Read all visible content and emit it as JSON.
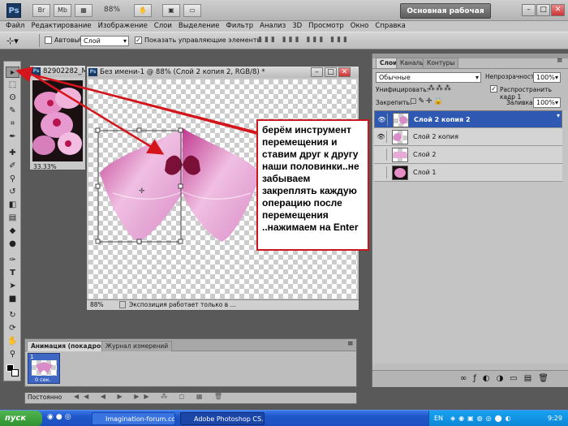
{
  "app": {
    "logo": "Ps",
    "zoom": "88%",
    "workspace": "Основная рабочая среда",
    "window_controls": [
      "–",
      "□",
      "✕"
    ]
  },
  "menu": [
    "Файл",
    "Редактирование",
    "Изображение",
    "Слои",
    "Выделение",
    "Фильтр",
    "Анализ",
    "3D",
    "Просмотр",
    "Окно",
    "Справка"
  ],
  "options": {
    "autoselect_label": "Автовыбор:",
    "autoselect_value": "Слой",
    "show_controls_label": "Показать управляющие элементы"
  },
  "doc_small": {
    "title": "82902282_M...",
    "zoom": "33.33%"
  },
  "doc_main": {
    "title": "Без имени-1 @ 88% (Слой 2 копия 2, RGB/8) *",
    "zoom": "88%",
    "status": "Экспозиция работает только в ..."
  },
  "callout": "берём инструмент перемещения и ставим  друг к другу наши половинки..не забываем закреплять каждую операцию после перемещения ..нажимаем на Enter",
  "layers_panel": {
    "tabs": [
      "Слои",
      "Каналы",
      "Контуры"
    ],
    "blend_mode": "Обычные",
    "opacity_label": "Непрозрачность:",
    "opacity_value": "100%",
    "unify_label": "Унифицировать:",
    "propagate_label": "Распространить кадр 1",
    "lock_label": "Закрепить:",
    "fill_label": "Заливка:",
    "fill_value": "100%",
    "layers": [
      {
        "name": "Слой 2 копия 2",
        "selected": true,
        "visible": true
      },
      {
        "name": "Слой 2 копия",
        "selected": false,
        "visible": true
      },
      {
        "name": "Слой 2",
        "selected": false,
        "visible": false
      },
      {
        "name": "Слой 1",
        "selected": false,
        "visible": false
      }
    ]
  },
  "animation_panel": {
    "tabs": [
      "Анимация (покадровая)",
      "Журнал измерений"
    ],
    "frame_number": "1",
    "frame_delay": "0 сек.",
    "loop": "Постоянно"
  },
  "taskbar": {
    "start": "пуск",
    "tasks": [
      "Imagination-forum.co...",
      "Adobe Photoshop CS..."
    ],
    "lang": "EN",
    "time": "9:29"
  },
  "colors": {
    "selected_layer": "#2f58b3",
    "callout_border": "#c8161d",
    "arrow": "#d4151b",
    "taskbar": "#1f56c8"
  }
}
